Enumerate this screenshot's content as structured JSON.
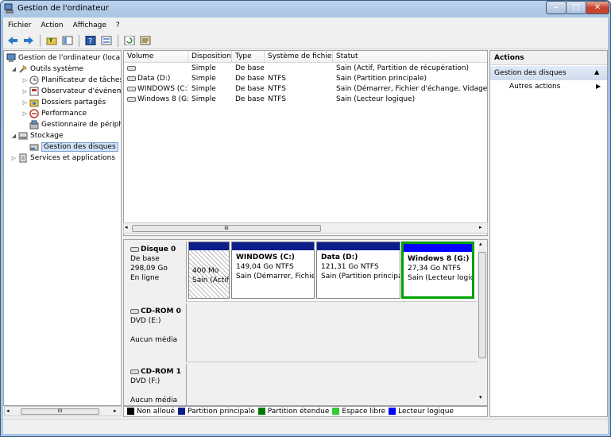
{
  "window": {
    "title": "Gestion de l'ordinateur",
    "min": "–",
    "max": "□",
    "close": "✕"
  },
  "menu": [
    "Fichier",
    "Action",
    "Affichage",
    "?"
  ],
  "tree": {
    "root": "Gestion de l'ordinateur (local)",
    "outils": "Outils système",
    "planif": "Planificateur de tâches",
    "observ": "Observateur d'événements",
    "dossiers": "Dossiers partagés",
    "perf": "Performance",
    "periph": "Gestionnaire de périphériques",
    "stockage": "Stockage",
    "disques": "Gestion des disques",
    "services": "Services et applications",
    "scroll_grip": "III"
  },
  "volumes": {
    "headers": [
      "Volume",
      "Disposition",
      "Type",
      "Système de fichiers",
      "Statut"
    ],
    "rows": [
      {
        "volume": "",
        "disposition": "Simple",
        "type": "De base",
        "fs": "",
        "statut": "Sain (Actif, Partition de récupération)"
      },
      {
        "volume": "Data (D:)",
        "disposition": "Simple",
        "type": "De base",
        "fs": "NTFS",
        "statut": "Sain (Partition principale)"
      },
      {
        "volume": "WINDOWS (C:)",
        "disposition": "Simple",
        "type": "De base",
        "fs": "NTFS",
        "statut": "Sain (Démarrer, Fichier d'échange, Vidage sur incident, Partition principale)"
      },
      {
        "volume": "Windows 8 (G:)",
        "disposition": "Simple",
        "type": "De base",
        "fs": "NTFS",
        "statut": "Sain (Lecteur logique)"
      }
    ],
    "scroll_grip": "III"
  },
  "disks": [
    {
      "name": "Disque 0",
      "l1": "De base",
      "l2": "298,09 Go",
      "l3": "En ligne",
      "parts": [
        {
          "title": "",
          "size": "400 Mo",
          "status": "Sain (Actif, Partition de récupération)"
        },
        {
          "title": "WINDOWS  (C:)",
          "size": "149,04 Go NTFS",
          "status": "Sain (Démarrer, Fichier d'échange)"
        },
        {
          "title": "Data  (D:)",
          "size": "121,31 Go NTFS",
          "status": "Sain (Partition principale)"
        },
        {
          "title": "Windows 8  (G:)",
          "size": "27,34 Go NTFS",
          "status": "Sain (Lecteur logique)"
        }
      ]
    },
    {
      "name": "CD-ROM 0",
      "l1": "DVD (E:)",
      "l2": "",
      "l3": "Aucun média"
    },
    {
      "name": "CD-ROM 1",
      "l1": "DVD (F:)",
      "l2": "",
      "l3": "Aucun média"
    }
  ],
  "legend": [
    {
      "label": "Non alloué",
      "color": "#000000"
    },
    {
      "label": "Partition principale",
      "color": "#0a1e8c"
    },
    {
      "label": "Partition étendue",
      "color": "#007a00"
    },
    {
      "label": "Espace libre",
      "color": "#33cc33"
    },
    {
      "label": "Lecteur logique",
      "color": "#0000ff"
    }
  ],
  "actions": {
    "title": "Actions",
    "section": "Gestion des disques",
    "more": "Autres actions"
  }
}
